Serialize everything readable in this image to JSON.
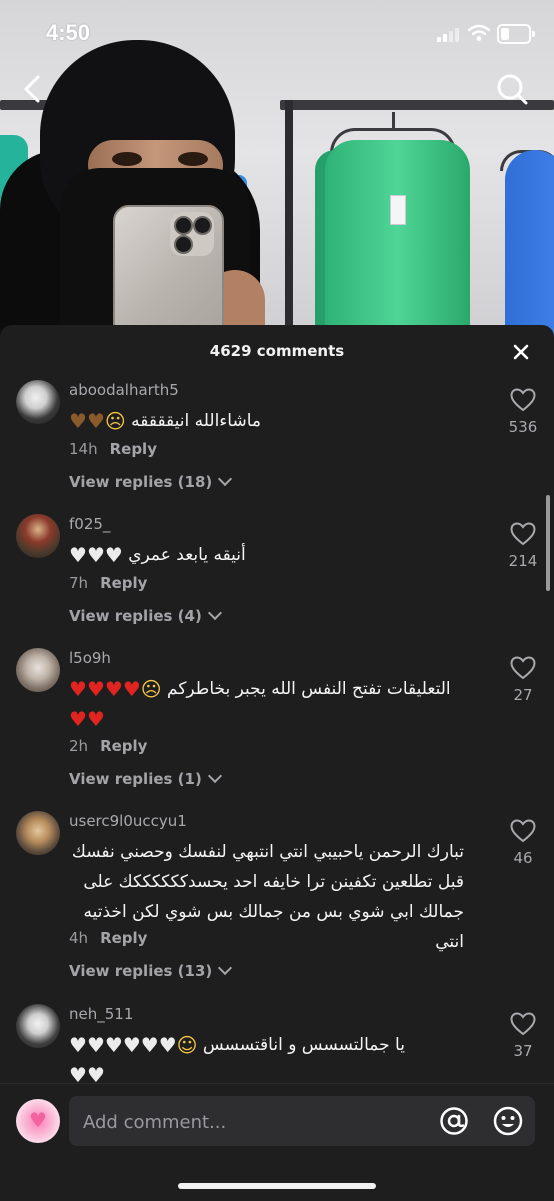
{
  "status_bar": {
    "time": "4:50"
  },
  "comments_header": {
    "count_label": "4629 comments"
  },
  "comments": [
    {
      "username": "aboodalharth5",
      "text": "ماشاءالله انيققققه",
      "emojis": [
        "brown-heart",
        "brown-heart",
        "frowning-face"
      ],
      "age": "14h",
      "reply_label": "Reply",
      "view_replies": "View replies (18)",
      "likes": "536"
    },
    {
      "username": "f025_",
      "text": "أنيقه يابعد عمري",
      "emojis": [
        "white-heart",
        "white-heart",
        "white-heart"
      ],
      "age": "7h",
      "reply_label": "Reply",
      "view_replies": "View replies (4)",
      "likes": "214"
    },
    {
      "username": "l5o9h",
      "text": "التعليقات تفتح النفس الله يجبر بخاطركم",
      "emojis": [
        "red-heart",
        "red-heart",
        "red-heart",
        "red-heart",
        "loudly-crying-face",
        "red-heart",
        "red-heart"
      ],
      "age": "2h",
      "reply_label": "Reply",
      "view_replies": "View replies (1)",
      "likes": "27"
    },
    {
      "username": "userc9l0uccyu1",
      "text_lines": [
        "تبارك الرحمن ياحبيبي انتي انتبهي لنفسك وحصني نفسك",
        "قبل تطلعين تكفينن ترا خايفه احد يحسدككككككك على",
        "جمالك ابي شوي بس من جمالك بس شوي لكن اخذتيه انتي"
      ],
      "age": "4h",
      "reply_label": "Reply",
      "view_replies": "View replies (13)",
      "likes": "46"
    },
    {
      "username": "neh_511",
      "text": "يا جمالتسسس و اناقتسسس",
      "emojis": [
        "white-heart",
        "white-heart",
        "white-heart",
        "white-heart",
        "white-heart",
        "white-heart",
        "star-struck-face",
        "white-heart",
        "white-heart"
      ],
      "likes": "37"
    }
  ],
  "composer": {
    "placeholder": "Add comment..."
  },
  "colors": {
    "sheet_bg": "#1e1e1f",
    "secondary_text": "#a9a9ad"
  },
  "icons": [
    "back-chevron-icon",
    "search-icon",
    "close-icon",
    "heart-outline-icon",
    "at-sign-icon",
    "emoji-icon"
  ]
}
